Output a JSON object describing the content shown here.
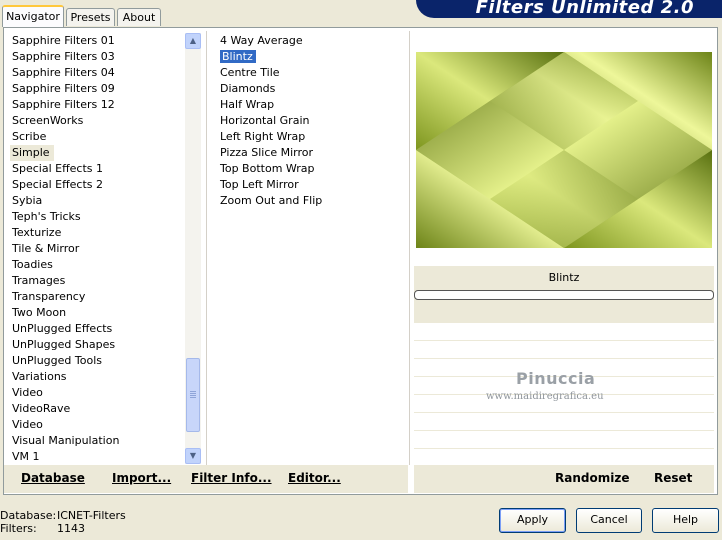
{
  "window_title": "Filters Unlimited 2.0",
  "tabs": [
    {
      "label": "Navigator",
      "active": true
    },
    {
      "label": "Presets",
      "active": false
    },
    {
      "label": "About",
      "active": false
    }
  ],
  "categories": [
    "Sapphire Filters 01",
    "Sapphire Filters 03",
    "Sapphire Filters 04",
    "Sapphire Filters 09",
    "Sapphire Filters 12",
    "ScreenWorks",
    "Scribe",
    "Simple",
    "Special Effects 1",
    "Special Effects 2",
    "Sybia",
    "Teph's Tricks",
    "Texturize",
    "Tile & Mirror",
    "Toadies",
    "Tramages",
    "Transparency",
    "Two Moon",
    "UnPlugged Effects",
    "UnPlugged Shapes",
    "UnPlugged Tools",
    "Variations",
    "Video",
    "VideoRave",
    "Video",
    "Visual Manipulation",
    "VM 1"
  ],
  "selected_category": "Simple",
  "filters": [
    "4 Way Average",
    "Blintz",
    "Centre Tile",
    "Diamonds",
    "Half Wrap",
    "Horizontal Grain",
    "Left Right Wrap",
    "Pizza Slice Mirror",
    "Top Bottom Wrap",
    "Top Left Mirror",
    "Zoom Out and Flip"
  ],
  "selected_filter": "Blintz",
  "preview": {
    "caption": "Blintz",
    "progress": 0
  },
  "watermark": {
    "name": "Pinuccia",
    "site": "www.maidiregrafica.eu"
  },
  "buttons": {
    "database": "Database",
    "import": "Import...",
    "filter_info": "Filter Info...",
    "editor": "Editor...",
    "randomize": "Randomize",
    "reset": "Reset",
    "apply": "Apply",
    "cancel": "Cancel",
    "help": "Help"
  },
  "status": {
    "database_label": "Database:",
    "database_value": "ICNET-Filters",
    "filters_label": "Filters:",
    "filters_value": "1143"
  },
  "colors": {
    "selection_blue": "#316ac5",
    "title_banner": "#0a246a",
    "preview_light": "#e4f08a",
    "preview_dark": "#5a7010"
  }
}
